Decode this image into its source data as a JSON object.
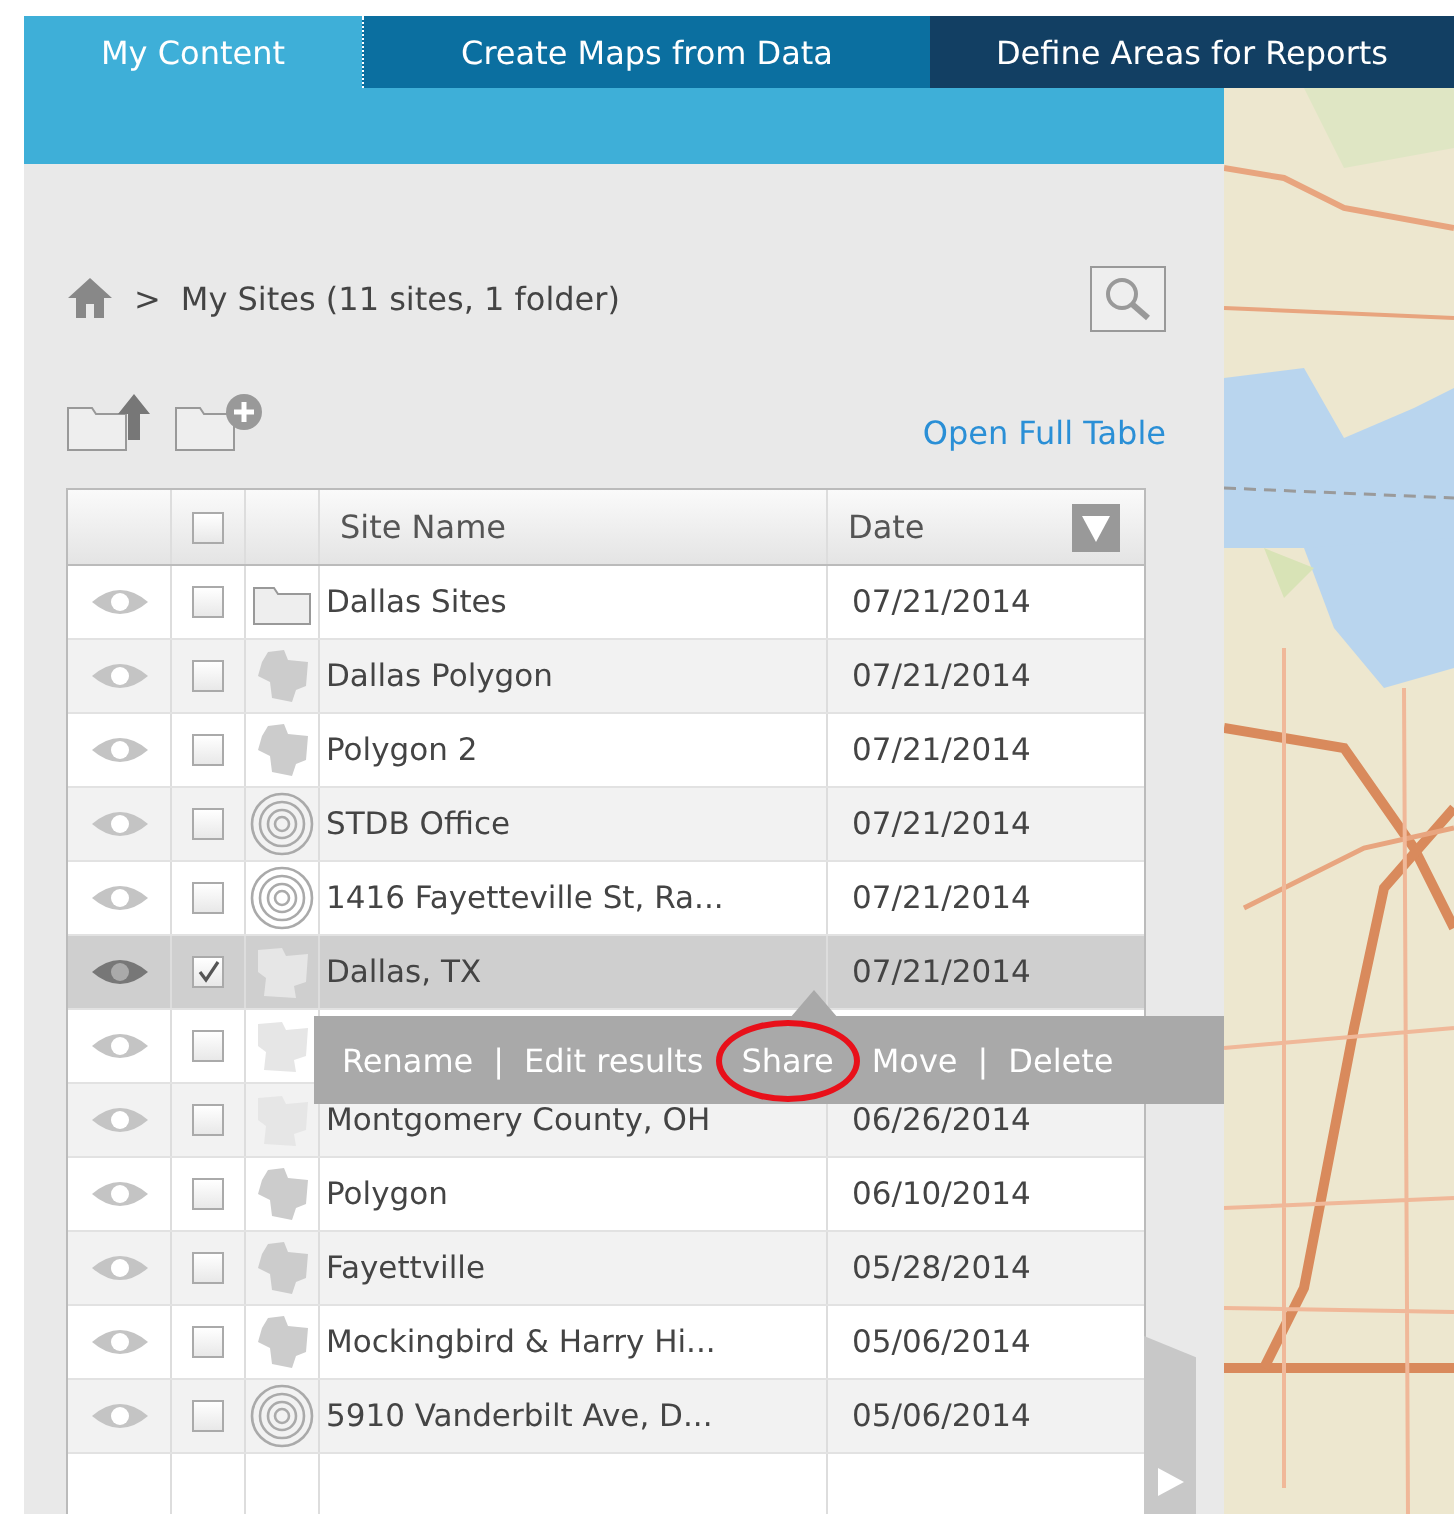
{
  "tabs": [
    {
      "label": "My Content",
      "selected": true
    },
    {
      "label": "Create Maps from Data",
      "selected": false
    },
    {
      "label": "Define Areas for Reports",
      "selected": false
    }
  ],
  "breadcrumb": {
    "path": "My Sites (11 sites, 1 folder)",
    "separator": ">"
  },
  "open_full_table": "Open Full Table",
  "table": {
    "columns": [
      "Site Name",
      "Date"
    ],
    "header_checked": false,
    "rows": [
      {
        "kind": "folder",
        "name": "Dallas Sites",
        "date": "07/21/2014",
        "checked": false,
        "selected": false
      },
      {
        "kind": "polygon",
        "name": "Dallas Polygon",
        "date": "07/21/2014",
        "checked": false,
        "selected": false
      },
      {
        "kind": "polygon",
        "name": "Polygon 2",
        "date": "07/21/2014",
        "checked": false,
        "selected": false
      },
      {
        "kind": "ring",
        "name": "STDB Office",
        "date": "07/21/2014",
        "checked": false,
        "selected": false
      },
      {
        "kind": "ring",
        "name": "1416 Fayetteville St, Ra...",
        "date": "07/21/2014",
        "checked": false,
        "selected": false
      },
      {
        "kind": "faint",
        "name": "Dallas, TX",
        "date": "07/21/2014",
        "checked": true,
        "selected": true
      },
      {
        "kind": "faint",
        "checked": false,
        "selected": false
      },
      {
        "kind": "faint",
        "name": "Montgomery County, OH",
        "date": "06/26/2014",
        "checked": false,
        "selected": false
      },
      {
        "kind": "polygon",
        "name": "Polygon",
        "date": "06/10/2014",
        "checked": false,
        "selected": false
      },
      {
        "kind": "polygon",
        "name": "Fayettville",
        "date": "05/28/2014",
        "checked": false,
        "selected": false
      },
      {
        "kind": "polygon",
        "name": "Mockingbird & Harry Hi...",
        "date": "05/06/2014",
        "checked": false,
        "selected": false
      },
      {
        "kind": "ring",
        "name": "5910 Vanderbilt Ave, D...",
        "date": "05/06/2014",
        "checked": false,
        "selected": false
      }
    ]
  },
  "context_menu": [
    {
      "kind": "action",
      "label": "Rename",
      "highlighted": false
    },
    {
      "kind": "separator",
      "label": "|"
    },
    {
      "kind": "action",
      "label": "Edit results",
      "highlighted": false
    },
    {
      "kind": "action",
      "label": "Share",
      "highlighted": true
    },
    {
      "kind": "action",
      "label": "Move",
      "highlighted": false
    },
    {
      "kind": "separator",
      "label": "|"
    },
    {
      "kind": "action",
      "label": "Delete",
      "highlighted": false
    }
  ]
}
